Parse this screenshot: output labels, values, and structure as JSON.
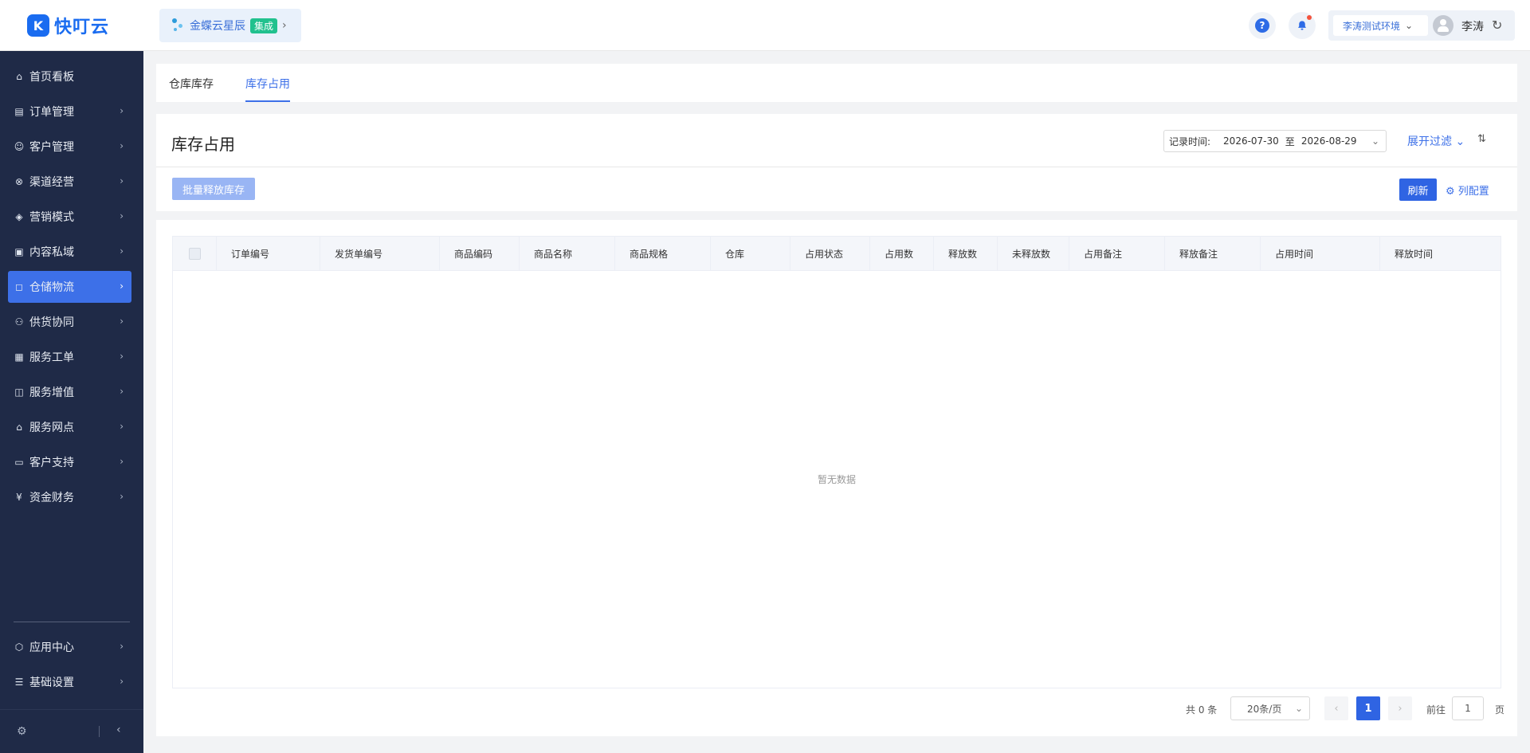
{
  "header": {
    "brand": "快叮云",
    "brand_mark": "K",
    "integration_name": "金蝶云星辰",
    "integration_badge": "集成",
    "help_label": "?",
    "environment": "李涛测试环境",
    "user_name": "李涛"
  },
  "sidebar": {
    "items": [
      {
        "label": "首页看板",
        "icon": "home-icon",
        "glyph": "⌂",
        "active": false,
        "has_children": false
      },
      {
        "label": "订单管理",
        "icon": "clipboard-icon",
        "glyph": "▤",
        "active": false,
        "has_children": true
      },
      {
        "label": "客户管理",
        "icon": "user-icon",
        "glyph": "☺",
        "active": false,
        "has_children": true
      },
      {
        "label": "渠道经营",
        "icon": "channel-icon",
        "glyph": "⊗",
        "active": false,
        "has_children": true
      },
      {
        "label": "营销模式",
        "icon": "tag-icon",
        "glyph": "◈",
        "active": false,
        "has_children": true
      },
      {
        "label": "内容私域",
        "icon": "image-icon",
        "glyph": "▣",
        "active": false,
        "has_children": true
      },
      {
        "label": "仓储物流",
        "icon": "box-icon",
        "glyph": "◻",
        "active": true,
        "has_children": true
      },
      {
        "label": "供货协同",
        "icon": "supply-icon",
        "glyph": "⚇",
        "active": false,
        "has_children": true
      },
      {
        "label": "服务工单",
        "icon": "ticket-icon",
        "glyph": "▦",
        "active": false,
        "has_children": true
      },
      {
        "label": "服务增值",
        "icon": "bag-icon",
        "glyph": "◫",
        "active": false,
        "has_children": true
      },
      {
        "label": "服务网点",
        "icon": "store-icon",
        "glyph": "⌂",
        "active": false,
        "has_children": true
      },
      {
        "label": "客户支持",
        "icon": "support-icon",
        "glyph": "▭",
        "active": false,
        "has_children": true
      },
      {
        "label": "资金财务",
        "icon": "yen-icon",
        "glyph": "¥",
        "active": false,
        "has_children": true
      }
    ],
    "bottom_items": [
      {
        "label": "应用中心",
        "icon": "cube-icon",
        "glyph": "⬡"
      },
      {
        "label": "基础设置",
        "icon": "settings-list-icon",
        "glyph": "☰"
      }
    ]
  },
  "tabs": [
    {
      "label": "仓库库存",
      "active": false
    },
    {
      "label": "库存占用",
      "active": true
    }
  ],
  "panel": {
    "title": "库存占用",
    "date_label": "记录时间:",
    "date_start": "2026-07-30",
    "date_sep": "至",
    "date_end": "2026-08-29",
    "expand_filter": "展开过滤",
    "batch_release": "批量释放库存",
    "refresh": "刷新",
    "column_config": "列配置"
  },
  "table": {
    "columns": [
      "订单编号",
      "发货单编号",
      "商品编码",
      "商品名称",
      "商品规格",
      "仓库",
      "占用状态",
      "占用数",
      "释放数",
      "未释放数",
      "占用备注",
      "释放备注",
      "占用时间",
      "释放时间"
    ],
    "empty_text": "暂无数据"
  },
  "pagination": {
    "total": "共 0 条",
    "page_size": "20条/页",
    "current_page": "1",
    "goto_label": "前往",
    "goto_value": "1",
    "page_suffix": "页"
  },
  "colors": {
    "primary": "#3d70e8",
    "sidebar_bg": "#1f2a47",
    "disabled_btn": "#99b5f4"
  }
}
